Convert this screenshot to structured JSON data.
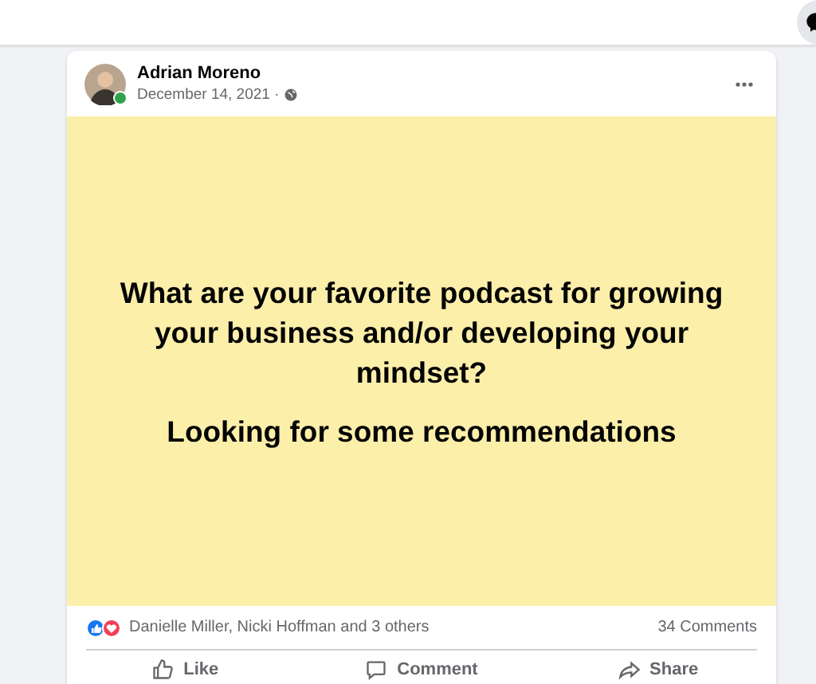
{
  "post": {
    "author": "Adrian Moreno",
    "author_online": true,
    "date": "December 14, 2021 ·",
    "headline": "What are your favorite podcast for growing your business and/or developing your mindset?",
    "subline": "Looking for some recommendations",
    "reactions_text": "Danielle Miller, Nicki Hoffman and 3 others",
    "comments_count": "34 Comments",
    "actions": [
      {
        "kind": "like",
        "label": "Like"
      },
      {
        "kind": "comment",
        "label": "Comment"
      },
      {
        "kind": "share",
        "label": "Share"
      }
    ]
  }
}
